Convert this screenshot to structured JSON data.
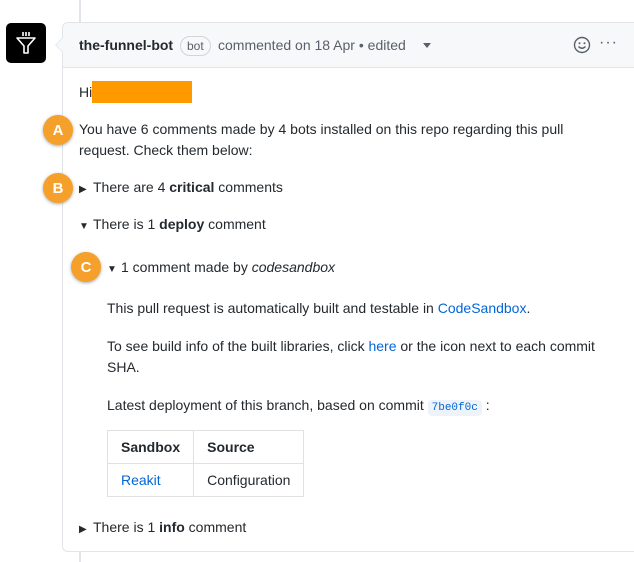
{
  "header": {
    "author": "the-funnel-bot",
    "bot_label": "bot",
    "meta": "commented on 18 Apr • edited",
    "more_label": "···"
  },
  "icons": {
    "avatar": "funnel-icon",
    "emoji": "smiley-icon",
    "edited_dropdown": "chevron-down-icon",
    "more": "kebab-icon"
  },
  "badges": {
    "a": "A",
    "b": "B",
    "c": "C"
  },
  "body": {
    "greeting": "Hi",
    "intro_line1": "You have 6 comments made by 4 bots installed on this repo regarding this pull",
    "intro_line2": "request. Check them below:",
    "critical": {
      "prefix": "There are 4 ",
      "strong": "critical",
      "suffix": " comments"
    },
    "deploy": {
      "prefix": "There is 1 ",
      "strong": "deploy",
      "suffix": " comment"
    },
    "made_by": {
      "prefix": "1 comment made by ",
      "em": "codesandbox"
    },
    "built_prefix": "This pull request is automatically built and testable in ",
    "built_link": "CodeSandbox",
    "built_suffix": ".",
    "buildinfo_prefix": "To see build info of the built libraries, click ",
    "buildinfo_link": "here",
    "buildinfo_suffix": " or the icon next to each commit",
    "buildinfo_line2": "SHA.",
    "latest_prefix": "Latest deployment of this branch, based on commit ",
    "commit": "7be0f0c",
    "latest_suffix": " :",
    "table": {
      "headers": [
        "Sandbox",
        "Source"
      ],
      "rows": [
        [
          "Reakit",
          "Configuration"
        ]
      ]
    },
    "info": {
      "prefix": "There is 1 ",
      "strong": "info",
      "suffix": " comment"
    }
  },
  "colors": {
    "accent": "#0366d6",
    "badge": "#f4a02a",
    "redaction": "#ff9900"
  }
}
